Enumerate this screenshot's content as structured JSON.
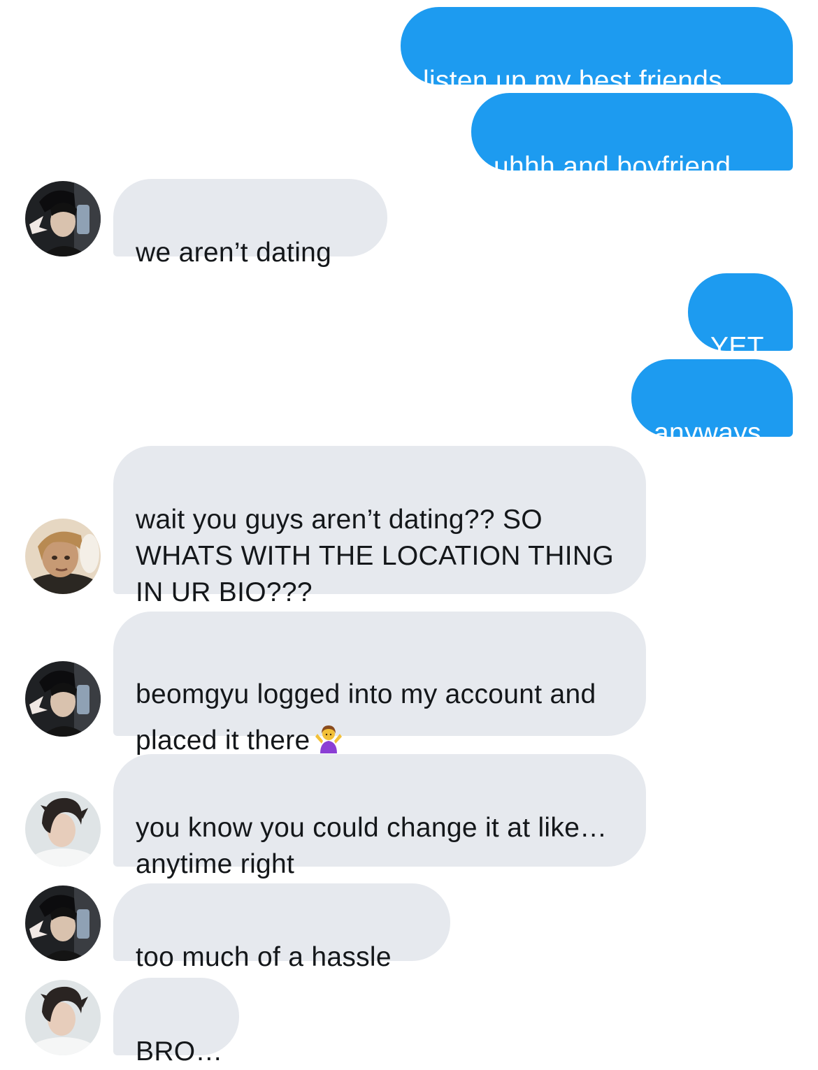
{
  "messages": [
    {
      "text": "listen up my best friends",
      "direction": "sent"
    },
    {
      "text": "uhhh and boyfriend",
      "direction": "sent"
    },
    {
      "text": "we aren’t dating",
      "direction": "received",
      "avatar": "avatar-1"
    },
    {
      "text": "YET.",
      "direction": "sent"
    },
    {
      "text": "anyways",
      "direction": "sent"
    },
    {
      "text": "wait you guys aren’t dating?? SO WHATS WITH THE LOCATION THING IN UR BIO???",
      "direction": "received",
      "avatar": "avatar-2"
    },
    {
      "text": "beomgyu logged into my account and placed it there",
      "emoji": "person-shrugging-icon",
      "direction": "received",
      "avatar": "avatar-1"
    },
    {
      "text": "you know you could change it at like… anytime right",
      "direction": "received",
      "avatar": "avatar-3"
    },
    {
      "text": "too much of a hassle",
      "direction": "received",
      "avatar": "avatar-1"
    },
    {
      "text": "BRO…",
      "direction": "received",
      "avatar": "avatar-3"
    }
  ],
  "colors": {
    "sent_bubble": "#1d9bf0",
    "received_bubble": "#e6e9ee",
    "sent_text": "#ffffff",
    "received_text": "#14171a"
  }
}
